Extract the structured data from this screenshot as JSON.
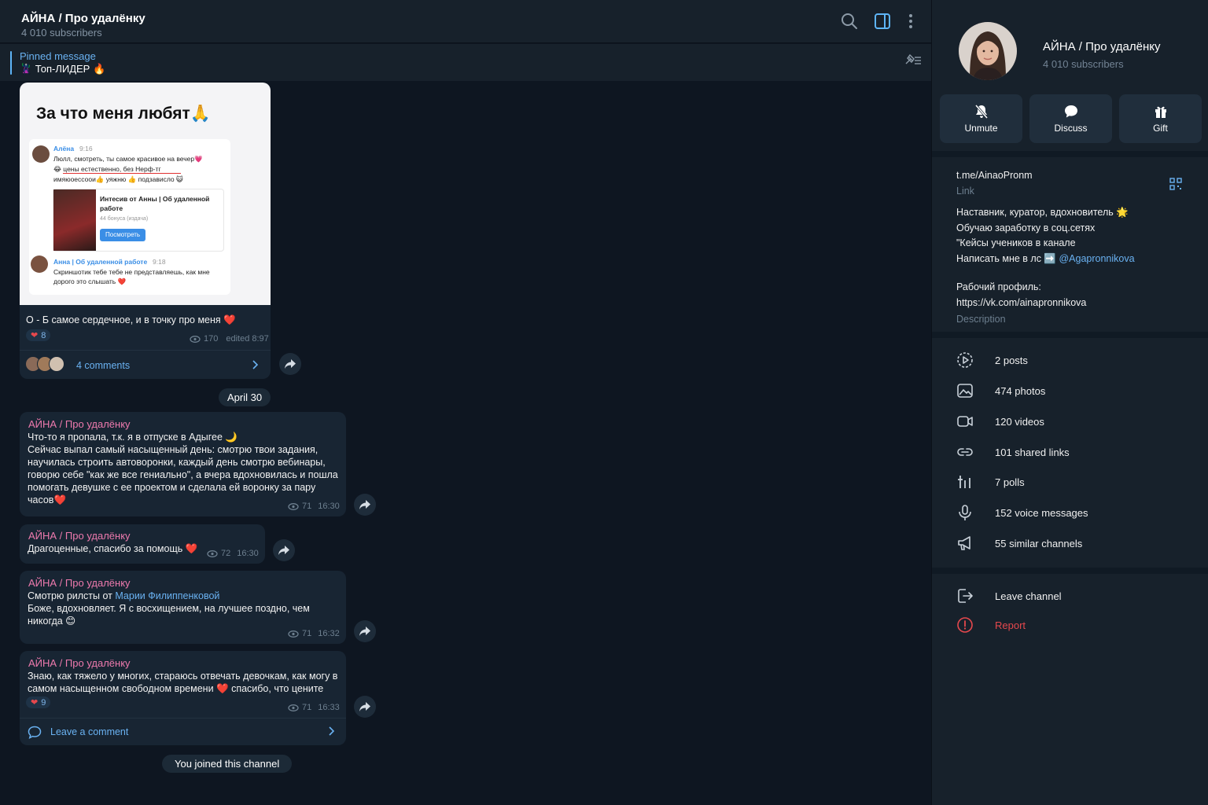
{
  "header": {
    "title": "АЙНА / Про удалёнку",
    "subscribers": "4 010 subscribers"
  },
  "pinned": {
    "label": "Pinned message",
    "text": "🦹 Топ-ЛИДЕР 🔥"
  },
  "photo_post": {
    "image_title": "За что меня любят🙏",
    "mini_name1": "Алёна",
    "mini_time1": "9:16",
    "mini_text1a": "Люлл, смотреть, ты самое красивое на вечер💗",
    "mini_text1b": "😂 цены естественно, без Нерф-тг",
    "mini_text1c": "имяюоессоои👍 уяжню 👍 подзависло 😺",
    "mini_card_title": "Интесив от Анны | Об удаленной работе",
    "mini_card_sub": "44 бонуса (издача)",
    "mini_card_btn": "Посмотреть",
    "mini_name2": "Анна | Об удаленной работе",
    "mini_time2": "9:18",
    "mini_text2": "Скриншотик тебе тебе не представляешь, как мне дорого это слышать ❤️",
    "caption": "О - Б самое сердечное, и в точку про меня ❤️",
    "reaction_count": "8",
    "views": "170",
    "edited": "edited 8:97",
    "comments": "4 comments"
  },
  "date_divider": "April 30",
  "messages": [
    {
      "author": "АЙНА / Про удалёнку",
      "lines": [
        "Что-то я пропала, т.к. я в отпуске в Адыгее 🌙",
        "Сейчас выпал самый насыщенный день: смотрю твои задания,",
        "научилась строить автоворонки, каждый день смотрю вебинары,",
        "говорю себе \"как же все гениально\", а вчера вдохновилась и пошла",
        "помогать девушке с ее проектом и сделала ей воронку за пару",
        "часов❤️"
      ],
      "views": "71",
      "time": "16:30"
    },
    {
      "author": "АЙНА / Про удалёнку",
      "text": "Драгоценные, спасибо за помощь ❤️",
      "views": "72",
      "time": "16:30"
    },
    {
      "author": "АЙНА / Про удалёнку",
      "text_prefix": "Смотрю рилсты от ",
      "link": "Марии Филиппенковой",
      "lines": [
        "Боже, вдохновляет. Я с восхищением, на лучшее поздно, чем",
        "никогда 😊"
      ],
      "views": "71",
      "time": "16:32"
    },
    {
      "author": "АЙНА / Про удалёнку",
      "lines": [
        "Знаю, как тяжело у многих, стараюсь отвечать девочкам, как могу в",
        "самом насыщенном свободном времени ❤️ спасибо, что цените"
      ],
      "reaction_count": "9",
      "views": "71",
      "time": "16:33",
      "comment_label": "Leave a comment"
    }
  ],
  "joined": "You joined this channel",
  "sidebar": {
    "name": "АЙНА / Про удалёнку",
    "subscribers": "4 010 subscribers",
    "actions": [
      "Unmute",
      "Discuss",
      "Gift"
    ],
    "link": "t.me/AinaoPronm",
    "link_label": "Link",
    "bio": [
      "Наставник, куратор, вдохновитель 🌟",
      "Обучаю заработку в соц.сетях",
      "\"Кейсы учеников в канале"
    ],
    "bio_dm_prefix": "Написать мне в лс ➡️ ",
    "bio_dm_handle": "@Agapronnikova",
    "work_label": "Рабочий профиль:",
    "work_link": "https://vk.com/ainapronnikova",
    "description_label": "Description",
    "media": [
      {
        "icon": "posts-icon",
        "label": "2 posts"
      },
      {
        "icon": "photo-icon",
        "label": "474 photos"
      },
      {
        "icon": "video-icon",
        "label": "120 videos"
      },
      {
        "icon": "link-icon",
        "label": "101 shared links"
      },
      {
        "icon": "poll-icon",
        "label": "7 polls"
      },
      {
        "icon": "mic-icon",
        "label": "152 voice messages"
      },
      {
        "icon": "megaphone-icon",
        "label": "55 similar channels"
      }
    ],
    "leave": "Leave channel",
    "report": "Report"
  },
  "colors": {
    "background": "#0e1621",
    "panel": "#17212b",
    "bubble": "#182533",
    "accent": "#6ab2f2",
    "author": "#ee7aae",
    "danger": "#e5484d"
  }
}
